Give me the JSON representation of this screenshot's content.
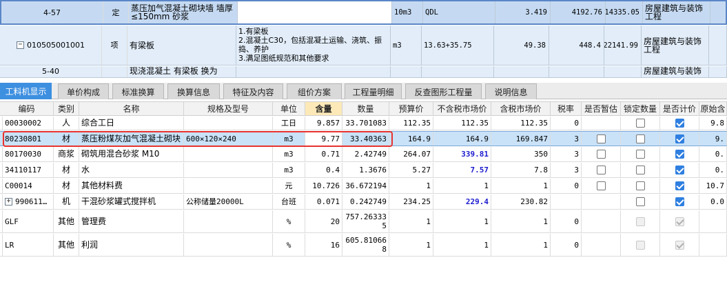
{
  "top_rows": [
    {
      "code": "4-57",
      "type": "定",
      "name": "蒸压加气混凝土砌块墙 墙厚≤150mm 砂浆",
      "spec": "",
      "unit": "10m3",
      "expr": "QDL",
      "qty": "3.419",
      "price": "4192.76",
      "total": "14335.05",
      "major": "房屋建筑与装饰工程"
    },
    {
      "code": "010505001001",
      "type": "项",
      "name": "有梁板",
      "spec": "1.有梁板\n2.混凝土C30，包括混凝土运输、浇筑、振捣、养护\n3.满足图纸规范和其他要求",
      "unit": "m3",
      "expr": "13.63+35.75",
      "qty": "49.38",
      "price": "448.4",
      "total": "22141.99",
      "major": "房屋建筑与装饰工程"
    },
    {
      "code": "5-40",
      "type": "",
      "name": "现浇混凝土 有梁板 换为",
      "spec": "",
      "unit": "",
      "expr": "",
      "qty": "",
      "price": "",
      "total": "",
      "major": "房屋建筑与装饰"
    }
  ],
  "tabs": [
    "工料机显示",
    "单价构成",
    "标准换算",
    "换算信息",
    "特征及内容",
    "组价方案",
    "工程量明细",
    "反查图形工程量",
    "说明信息"
  ],
  "columns": [
    "编码",
    "类别",
    "名称",
    "规格及型号",
    "单位",
    "含量",
    "数量",
    "预算价",
    "不含税市场价",
    "含税市场价",
    "税率",
    "是否暂估",
    "锁定数量",
    "是否计价",
    "原始含"
  ],
  "rows": [
    {
      "code": "00030002",
      "cat": "人",
      "name": "综合工日",
      "spec": "",
      "unit": "工日",
      "content": "9.857",
      "qty": "33.701083",
      "budget": "112.35",
      "market_ex": "112.35",
      "market_ex_blue": false,
      "market_in": "112.35",
      "tax": "0",
      "provisional": null,
      "locked": false,
      "priced": true,
      "priced_dis": false,
      "orig": "9.8"
    },
    {
      "code": "80230801",
      "cat": "材",
      "name": "蒸压粉煤灰加气混凝土砌块",
      "spec": "600×120×240",
      "unit": "m3",
      "content": "9.77",
      "qty": "33.40363",
      "budget": "164.9",
      "market_ex": "164.9",
      "market_ex_blue": false,
      "market_in": "169.847",
      "tax": "3",
      "provisional": false,
      "locked": false,
      "priced": true,
      "priced_dis": false,
      "orig": "9."
    },
    {
      "code": "80170030",
      "cat": "商浆",
      "name": "砌筑用混合砂浆 M10",
      "spec": "",
      "unit": "m3",
      "content": "0.71",
      "qty": "2.42749",
      "budget": "264.07",
      "market_ex": "339.81",
      "market_ex_blue": true,
      "market_in": "350",
      "tax": "3",
      "provisional": false,
      "locked": false,
      "priced": true,
      "priced_dis": false,
      "orig": "0."
    },
    {
      "code": "34110117",
      "cat": "材",
      "name": "水",
      "spec": "",
      "unit": "m3",
      "content": "0.4",
      "qty": "1.3676",
      "budget": "5.27",
      "market_ex": "7.57",
      "market_ex_blue": true,
      "market_in": "7.8",
      "tax": "3",
      "provisional": false,
      "locked": false,
      "priced": true,
      "priced_dis": false,
      "orig": "0."
    },
    {
      "code": "C00014",
      "cat": "材",
      "name": "其他材料费",
      "spec": "",
      "unit": "元",
      "content": "10.726",
      "qty": "36.672194",
      "budget": "1",
      "market_ex": "1",
      "market_ex_blue": false,
      "market_in": "1",
      "tax": "0",
      "provisional": false,
      "locked": false,
      "priced": true,
      "priced_dis": false,
      "orig": "10.7"
    },
    {
      "code": "990611…",
      "cat": "机",
      "name": "干混砂浆罐式搅拌机",
      "spec": "公称储量20000L",
      "unit": "台班",
      "content": "0.071",
      "qty": "0.242749",
      "budget": "234.25",
      "market_ex": "229.4",
      "market_ex_blue": true,
      "market_in": "230.82",
      "tax": "",
      "provisional": null,
      "locked": false,
      "priced": true,
      "priced_dis": false,
      "orig": "0.0",
      "expander": "+"
    },
    {
      "code": "GLF",
      "cat": "其他",
      "name": "管理费",
      "spec": "",
      "unit": "%",
      "content": "20",
      "qty": "757.26333\n5",
      "budget": "1",
      "market_ex": "1",
      "market_ex_blue": false,
      "market_in": "1",
      "tax": "0",
      "provisional": null,
      "locked": "dis",
      "priced": true,
      "priced_dis": true,
      "orig": ""
    },
    {
      "code": "LR",
      "cat": "其他",
      "name": "利润",
      "spec": "",
      "unit": "%",
      "content": "16",
      "qty": "605.81066\n8",
      "budget": "1",
      "market_ex": "1",
      "market_ex_blue": false,
      "market_in": "1",
      "tax": "0",
      "provisional": null,
      "locked": "dis",
      "priced": true,
      "priced_dis": true,
      "orig": ""
    }
  ],
  "colors": {
    "accent_tab": "#3d8fe0",
    "selected_row": "#c9e2f8",
    "highlight_header": "#fde9b8",
    "blue_value": "#1c1ccf",
    "annotation_box": "#e8322f"
  }
}
